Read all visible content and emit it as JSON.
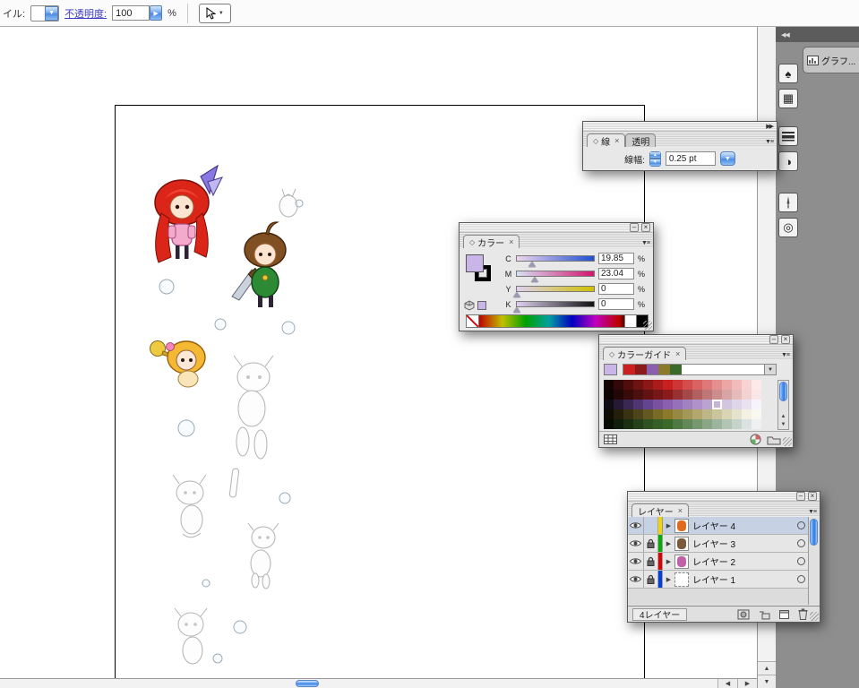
{
  "control_bar": {
    "style_label": "イル:",
    "opacity_label": "不透明度:",
    "opacity_value": "100",
    "percent_label": "%"
  },
  "icons": {
    "collapse_right": "▶▶",
    "collapse_left": "◀◀",
    "down_arrow": "▼",
    "up_arrow": "▲",
    "left_arrow": "◀",
    "right_arrow": "▶",
    "minimize": "–",
    "close": "×",
    "tab_marker": "◇",
    "panel_menu": "▼≡",
    "expand_triangle": "▶",
    "spade": "♠",
    "grid": "▦",
    "half_circle": "◑",
    "target": "◎"
  },
  "stroke_panel": {
    "tab_stroke": "線",
    "tab_transparency": "透明",
    "close_x": "×",
    "width_label": "線幅:",
    "width_value": "0.25 pt"
  },
  "color_panel": {
    "tab": "カラー",
    "close_x": "×",
    "percent_label": "%",
    "fill_color": "#c9b5e8",
    "channels": [
      {
        "label": "C",
        "value": "19.85",
        "percent": 19.85,
        "track_from": "#efd7ee",
        "track_to": "#1f4fd0"
      },
      {
        "label": "M",
        "value": "23.04",
        "percent": 23.04,
        "track_from": "#d6e0f4",
        "track_to": "#d4156e"
      },
      {
        "label": "Y",
        "value": "0",
        "percent": 0,
        "track_from": "#ded0f0",
        "track_to": "#cfc000"
      },
      {
        "label": "K",
        "value": "0",
        "percent": 0,
        "track_from": "#ded0f0",
        "track_to": "#101010"
      }
    ]
  },
  "color_guide": {
    "tab": "カラーガイド",
    "close_x": "×",
    "base_color": "#c9b5e8",
    "harmony": [
      "#cc2020",
      "#8b1a1a",
      "#8a5fb0",
      "#8a7a2a",
      "#3a6a2a"
    ],
    "selected": {
      "row": 2,
      "col": 11
    },
    "rows": [
      [
        "#140303",
        "#320808",
        "#500d0d",
        "#6e1212",
        "#8c1717",
        "#aa1b1b",
        "#c82020",
        "#cd3636",
        "#d34d4d",
        "#d96363",
        "#df7979",
        "#e59090",
        "#eba6a6",
        "#f1bcbc",
        "#f7d3d3",
        "#fde9e9"
      ],
      [
        "#0e0303",
        "#230707",
        "#380a0a",
        "#4d0e0e",
        "#621212",
        "#771616",
        "#8b1a1a",
        "#983131",
        "#a54848",
        "#b25f5f",
        "#bf7676",
        "#cc8d8d",
        "#d9a4a4",
        "#e6bbbb",
        "#f3d2d2",
        "#fae6e6"
      ],
      [
        "#100b14",
        "#251933",
        "#3a2752",
        "#4f3571",
        "#644390",
        "#7951a0",
        "#8a5fb0",
        "#9670b8",
        "#a281c0",
        "#ae92c8",
        "#baa3d0",
        "#c6b4d8",
        "#d2c5e0",
        "#ded6e8",
        "#eae2f0",
        "#f6f3fa"
      ],
      [
        "#0e0c04",
        "#231f0b",
        "#383212",
        "#4d4519",
        "#625820",
        "#776b25",
        "#8a7a2a",
        "#978941",
        "#a49858",
        "#b1a76f",
        "#beb686",
        "#cbc59d",
        "#d8d4b4",
        "#e5e3cb",
        "#f2f1e2",
        "#f9f8f0"
      ],
      [
        "#060b04",
        "#101d0b",
        "#1a2f12",
        "#244119",
        "#2e5320",
        "#346027",
        "#3a6a2a",
        "#4e7941",
        "#628858",
        "#76976f",
        "#8aa686",
        "#9eb59d",
        "#b2c4b4",
        "#c6d3cb",
        "#dae2e2",
        "#eef1f0"
      ]
    ]
  },
  "layers_panel": {
    "tab": "レイヤー",
    "close_x": "×",
    "count_label": "4レイヤー",
    "layers": [
      {
        "name": "レイヤー 4",
        "color": "#f5d400",
        "thumb": "#e06a20",
        "locked": false,
        "visible": true,
        "selected": true
      },
      {
        "name": "レイヤー 3",
        "color": "#00b000",
        "thumb": "#7a5a3a",
        "locked": true,
        "visible": true,
        "selected": false
      },
      {
        "name": "レイヤー 2",
        "color": "#e00000",
        "thumb": "#c060a8",
        "locked": true,
        "visible": true,
        "selected": false
      },
      {
        "name": "レイヤー 1",
        "color": "#0040e0",
        "thumb": "",
        "locked": true,
        "visible": true,
        "selected": false
      }
    ]
  },
  "right_dock": {
    "graph_tab": "グラフ..."
  }
}
